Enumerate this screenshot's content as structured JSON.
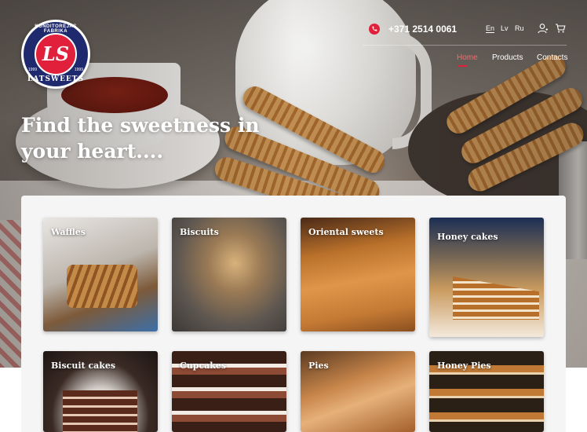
{
  "header": {
    "logo": {
      "monogram": "LS",
      "top_text": "KONDITOREJAS FABRIKA",
      "brand": "LATSWEETS",
      "year_left": "1999",
      "year_right": "1999"
    },
    "phone": "+371 2514 0061",
    "languages": [
      {
        "label": "En",
        "active": true
      },
      {
        "label": "Lv",
        "active": false
      },
      {
        "label": "Ru",
        "active": false
      }
    ],
    "icons": {
      "phone": "phone-icon",
      "user": "user-icon",
      "cart": "cart-icon"
    },
    "nav": [
      {
        "label": "Home",
        "active": true
      },
      {
        "label": "Products",
        "active": false
      },
      {
        "label": "Contacts",
        "active": false
      }
    ]
  },
  "hero": {
    "headline_line1": "Find the sweetness in",
    "headline_line2": "your heart...."
  },
  "products": [
    {
      "label": "Waffles"
    },
    {
      "label": "Biscuits"
    },
    {
      "label": "Oriental sweets"
    },
    {
      "label": "Honey cakes"
    },
    {
      "label": "Biscuit cakes"
    },
    {
      "label": "Cupcakes"
    },
    {
      "label": "Pies"
    },
    {
      "label": "Honey Pies"
    }
  ],
  "colors": {
    "accent": "#e1213b",
    "logo_blue": "#1f2a6e",
    "panel": "#f5f5f5"
  }
}
